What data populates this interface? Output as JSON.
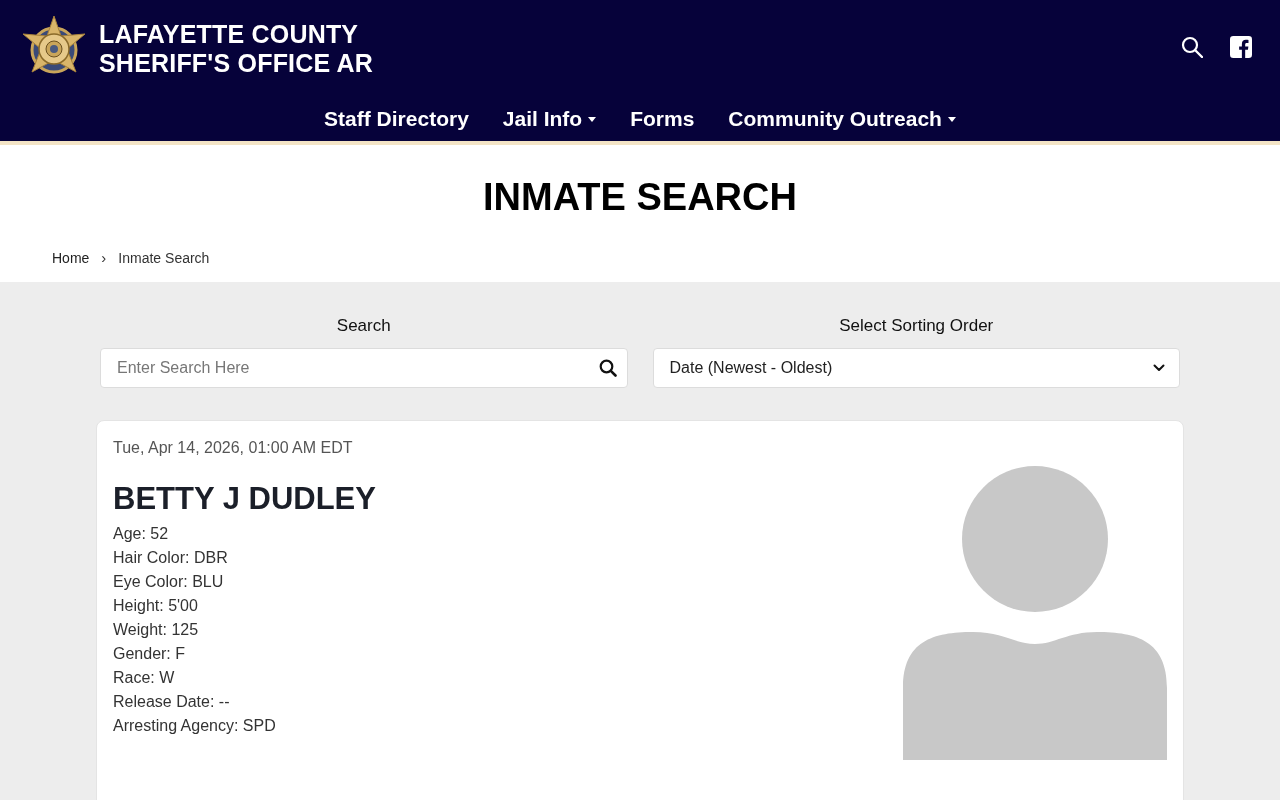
{
  "header": {
    "title_lines": [
      "LAFAYETTE COUNTY",
      "SHERIFF'S OFFICE AR"
    ]
  },
  "nav": [
    {
      "label": "Staff Directory",
      "has_dropdown": false
    },
    {
      "label": "Jail Info",
      "has_dropdown": true
    },
    {
      "label": "Forms",
      "has_dropdown": false
    },
    {
      "label": "Community Outreach",
      "has_dropdown": true
    }
  ],
  "page_title": "INMATE SEARCH",
  "breadcrumb": {
    "items": [
      "Home",
      "Inmate Search"
    ],
    "separator": "›"
  },
  "search": {
    "label": "Search",
    "placeholder": "Enter Search Here"
  },
  "sort": {
    "label": "Select Sorting Order",
    "value": "Date (Newest - Oldest)"
  },
  "inmates": [
    {
      "booking_time": "Tue, Apr 14, 2026, 01:00 AM EDT",
      "name": "BETTY J DUDLEY",
      "details": [
        "Age: 52",
        "Hair Color: DBR",
        "Eye Color: BLU",
        "Height: 5'00",
        "Weight: 125",
        "Gender: F",
        "Race: W",
        "Release Date: --",
        "Arresting Agency: SPD"
      ]
    }
  ]
}
